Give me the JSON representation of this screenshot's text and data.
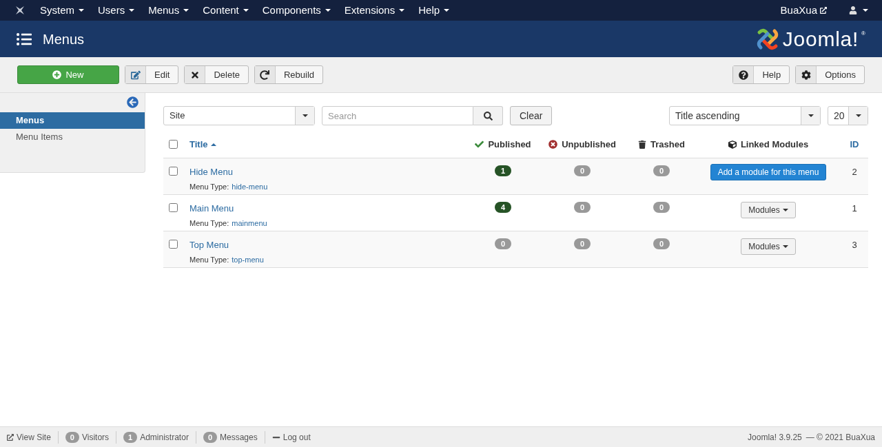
{
  "topnav": {
    "items": [
      "System",
      "Users",
      "Menus",
      "Content",
      "Components",
      "Extensions",
      "Help"
    ],
    "site_link": "BuaXua"
  },
  "header": {
    "title": "Menus",
    "logo_text": "Joomla!",
    "logo_mark": "®"
  },
  "toolbar": {
    "left": [
      {
        "kind": "new",
        "label": "New"
      },
      {
        "kind": "edit",
        "label": "Edit"
      },
      {
        "kind": "delete",
        "label": "Delete"
      },
      {
        "kind": "rebuild",
        "label": "Rebuild"
      }
    ],
    "right": [
      {
        "kind": "help",
        "label": "Help"
      },
      {
        "kind": "options",
        "label": "Options"
      }
    ]
  },
  "sidebar": {
    "items": [
      {
        "label": "Menus",
        "selected": true
      },
      {
        "label": "Menu Items",
        "selected": false
      }
    ]
  },
  "filters": {
    "client": "Site",
    "search": {
      "placeholder": "Search"
    },
    "clear": "Clear",
    "ordering": "Title ascending",
    "limit": "20"
  },
  "table": {
    "header_checked": false,
    "columns": [
      "Title",
      "Published",
      "Unpublished",
      "Trashed",
      "Linked Modules",
      "ID"
    ],
    "rows": [
      {
        "checked": false,
        "title": "Hide Menu",
        "type_label": "Menu Type:",
        "type": "hide-menu",
        "published": {
          "count": "1",
          "color": "#265326"
        },
        "unpublished": "0",
        "trashed": "0",
        "modules": {
          "kind": "add",
          "label": "Add a module for this menu"
        },
        "id": "2"
      },
      {
        "checked": false,
        "title": "Main Menu",
        "type_label": "Menu Type:",
        "type": "mainmenu",
        "published": {
          "count": "4",
          "color": "#265326"
        },
        "unpublished": "0",
        "trashed": "0",
        "modules": {
          "kind": "dropdown",
          "label": "Modules"
        },
        "id": "1"
      },
      {
        "checked": false,
        "title": "Top Menu",
        "type_label": "Menu Type:",
        "type": "top-menu",
        "published": {
          "count": "0",
          "color": "#999999"
        },
        "unpublished": "0",
        "trashed": "0",
        "modules": {
          "kind": "dropdown",
          "label": "Modules"
        },
        "id": "3"
      }
    ]
  },
  "status_bar": {
    "view_site": "View Site",
    "visitors": {
      "count": "0",
      "label": "Visitors"
    },
    "admins": {
      "count": "1",
      "label": "Administrator"
    },
    "messages": {
      "count": "0",
      "label": "Messages"
    },
    "logout": "Log out",
    "version": "Joomla! 3.9.25",
    "copyright": "— © 2021 BuaXua"
  }
}
